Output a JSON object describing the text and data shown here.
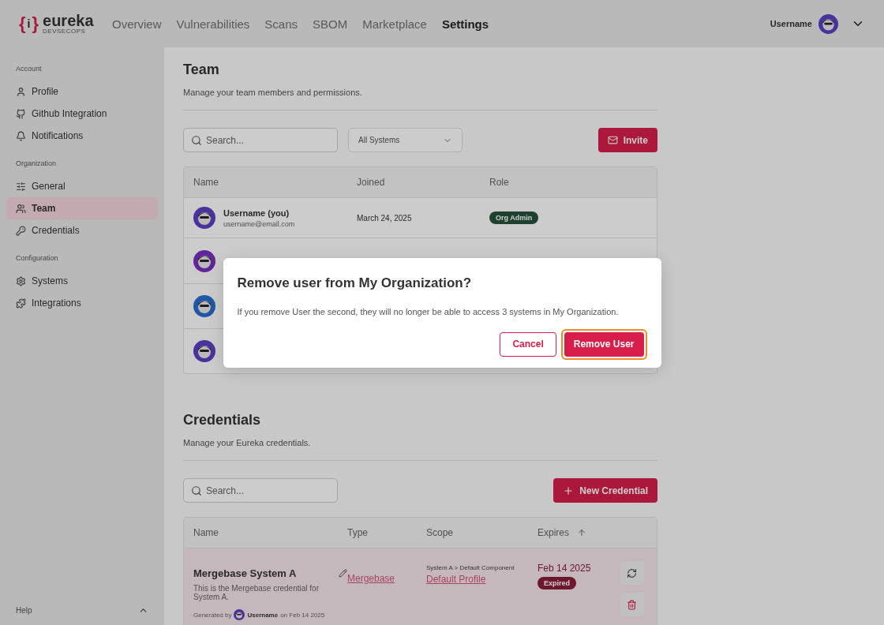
{
  "header": {
    "logo": {
      "brace_left": "{",
      "mark": "i",
      "brace_right": "}",
      "name": "eureka",
      "tagline": "DEVSECOPS"
    },
    "nav": [
      {
        "label": "Overview",
        "selected": false
      },
      {
        "label": "Vulnerabilities",
        "selected": false
      },
      {
        "label": "Scans",
        "selected": false
      },
      {
        "label": "SBOM",
        "selected": false
      },
      {
        "label": "Marketplace",
        "selected": false
      },
      {
        "label": "Settings",
        "selected": true
      }
    ],
    "user": {
      "name": "Username"
    }
  },
  "sidebar": {
    "sections": [
      {
        "title": "Account",
        "items": [
          {
            "label": "Profile",
            "selected": false
          },
          {
            "label": "Github Integration",
            "selected": false
          },
          {
            "label": "Notifications",
            "selected": false
          }
        ]
      },
      {
        "title": "Organization",
        "items": [
          {
            "label": "General",
            "selected": false
          },
          {
            "label": "Team",
            "selected": true
          },
          {
            "label": "Credentials",
            "selected": false
          }
        ]
      },
      {
        "title": "Configuration",
        "items": [
          {
            "label": "Systems",
            "selected": false
          },
          {
            "label": "Integrations",
            "selected": false
          }
        ]
      }
    ],
    "help": {
      "label": "Help"
    }
  },
  "team": {
    "title": "Team",
    "subtitle": "Manage your team members and permissions.",
    "search": {
      "placeholder": "Search..."
    },
    "filter": {
      "value": "All Systems"
    },
    "invite": "Invite",
    "columns": [
      "Name",
      "Joined",
      "Role"
    ],
    "rows": [
      {
        "kind": "member",
        "name": "Username (you)",
        "email": "username@email.com",
        "joined": "March 24, 2025",
        "role": "Org Admin"
      },
      {
        "kind": "covered"
      },
      {
        "kind": "covered"
      },
      {
        "kind": "covered"
      }
    ]
  },
  "credentials": {
    "title": "Credentials",
    "subtitle": "Manage your Eureka credentials.",
    "search": {
      "placeholder": "Search..."
    },
    "new_button": "New Credential",
    "columns": [
      "Name",
      "Type",
      "Scope",
      "Expires"
    ],
    "rows": [
      {
        "name": "Mergebase System A",
        "description": "This is the Mergebase credential for System A.",
        "generated_by": "Generated by",
        "user": "Username",
        "generated_on": "on Feb 14 2025",
        "type": "Mergebase",
        "scope_path": "System A > Default Component",
        "scope_link": "Default Profile",
        "expires": "Feb 14 2025",
        "status": "Expired",
        "expired": true
      }
    ]
  },
  "dialog": {
    "title": "Remove user from My Organization?",
    "message": "If you remove User the second, they will no longer be able to access 3 systems in My Organization.",
    "cancel": "Cancel",
    "confirm": "Remove User",
    "confirm_focused": true
  }
}
